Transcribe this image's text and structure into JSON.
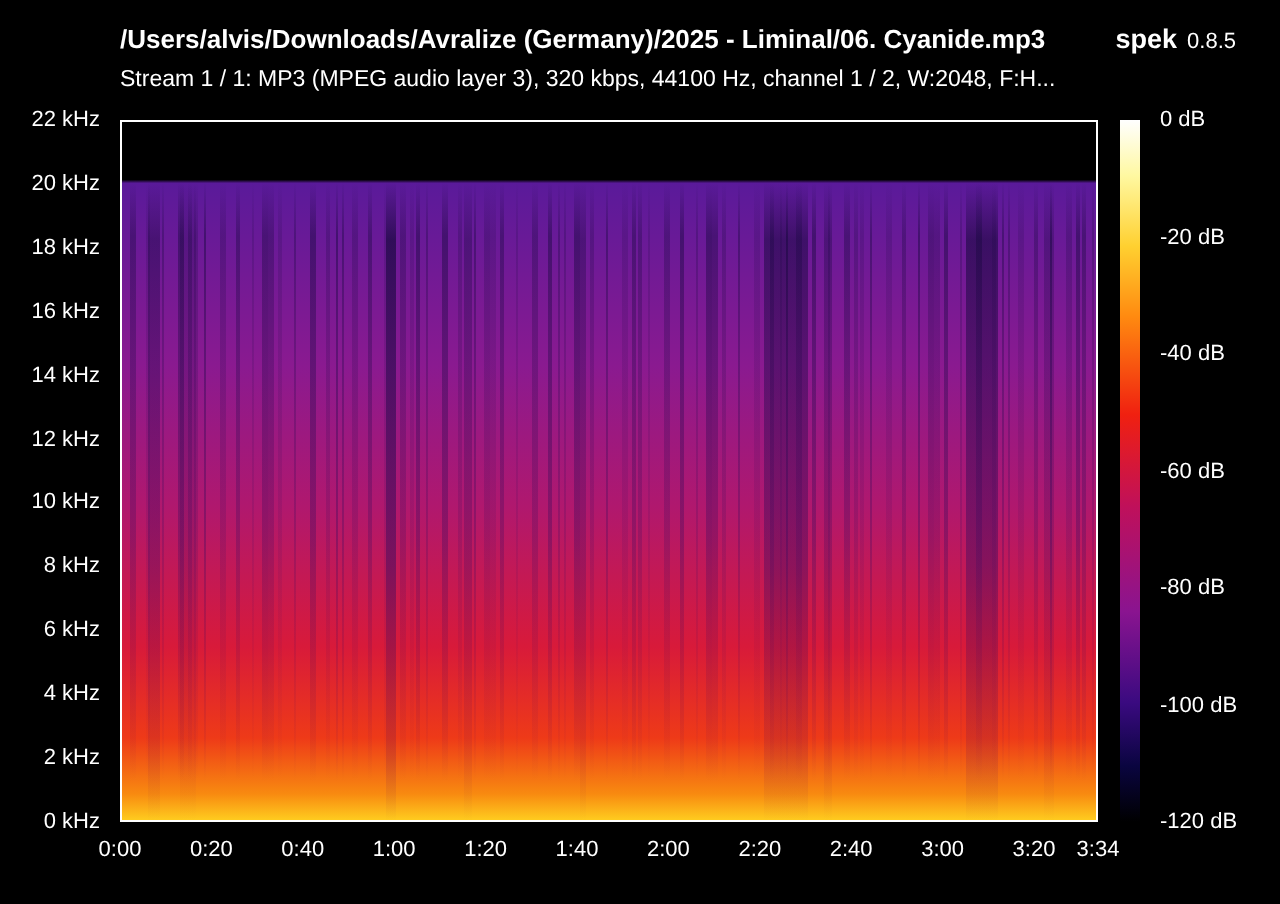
{
  "title": "/Users/alvis/Downloads/Avralize (Germany)/2025 - Liminal/06. Cyanide.mp3",
  "app": {
    "name": "spek",
    "version": "0.8.5"
  },
  "stream_info": "Stream 1 / 1: MP3 (MPEG audio layer 3), 320 kbps, 44100 Hz, channel 1 / 2, W:2048, F:H...",
  "frequency_axis": {
    "ticks": [
      "22 kHz",
      "20 kHz",
      "18 kHz",
      "16 kHz",
      "14 kHz",
      "12 kHz",
      "10 kHz",
      "8 kHz",
      "6 kHz",
      "4 kHz",
      "2 kHz",
      "0 kHz"
    ]
  },
  "time_axis": {
    "ticks": [
      "0:00",
      "0:20",
      "0:40",
      "1:00",
      "1:20",
      "1:40",
      "2:00",
      "2:20",
      "2:40",
      "3:00",
      "3:20",
      "3:34"
    ]
  },
  "level_scale": {
    "ticks": [
      "0 dB",
      "-20 dB",
      "-40 dB",
      "-60 dB",
      "-80 dB",
      "-100 dB",
      "-120 dB"
    ]
  }
}
